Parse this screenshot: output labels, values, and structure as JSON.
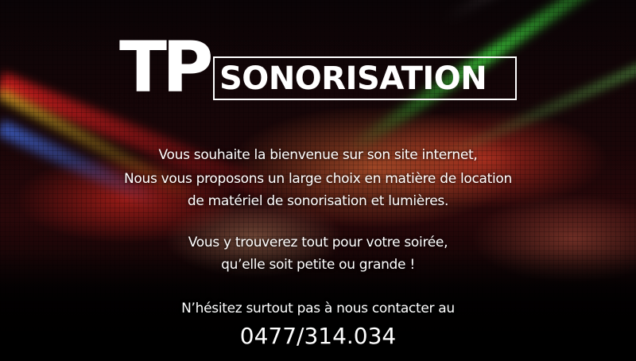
{
  "logo": {
    "tp": "TP",
    "word": "SONORISATION"
  },
  "intro": {
    "line1": "Vous souhaite la bienvenue sur son site internet,",
    "line2": "Nous vous proposons un large choix en matière de location",
    "line3": "de matériel de sonorisation et lumières."
  },
  "party": {
    "line1": "Vous y trouverez tout pour votre soirée,",
    "line2": "qu’elle soit petite ou grande !"
  },
  "contact": {
    "line": "N’hésitez surtout pas à nous contacter au",
    "phone": "0477/314.034"
  },
  "colors": {
    "text": "#ffffff",
    "background": "#000000",
    "beam_green": "#3cdc3c",
    "beam_red": "#dc1e1e"
  }
}
